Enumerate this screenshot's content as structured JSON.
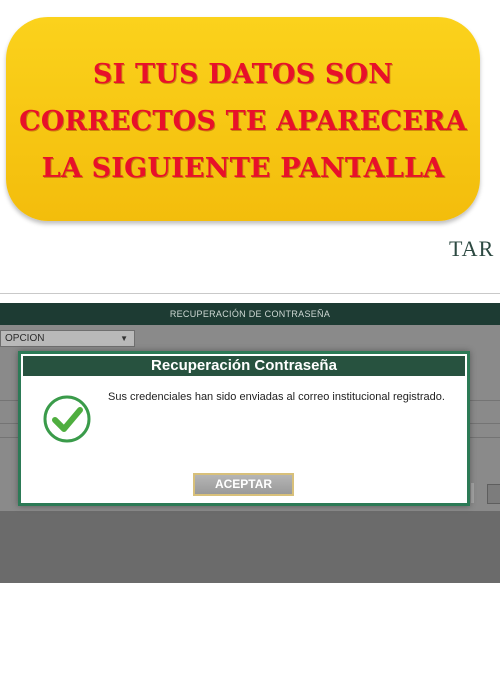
{
  "banner": {
    "lines": [
      "SI TUS DATOS SON",
      "CORRECTOS TE APARECERA",
      "LA SIGUIENTE PANTALLA"
    ]
  },
  "site_logo_text": "TAR",
  "screen": {
    "header_title": "RECUPERACIÓN DE CONTRASEÑA",
    "select_value": "OPCION"
  },
  "modal": {
    "title": "Recuperación Contraseña",
    "message": "Sus credenciales han sido enviadas al correo institucional registrado.",
    "accept_label": "ACEPTAR",
    "icon": "check-circle-icon"
  },
  "colors": {
    "banner_bg": "#f6c512",
    "banner_text": "#e8102a",
    "header_bg": "#1d3b33",
    "modal_title_bg": "#27523f",
    "modal_border": "#2c7a56",
    "check_green": "#3a9b4a"
  }
}
